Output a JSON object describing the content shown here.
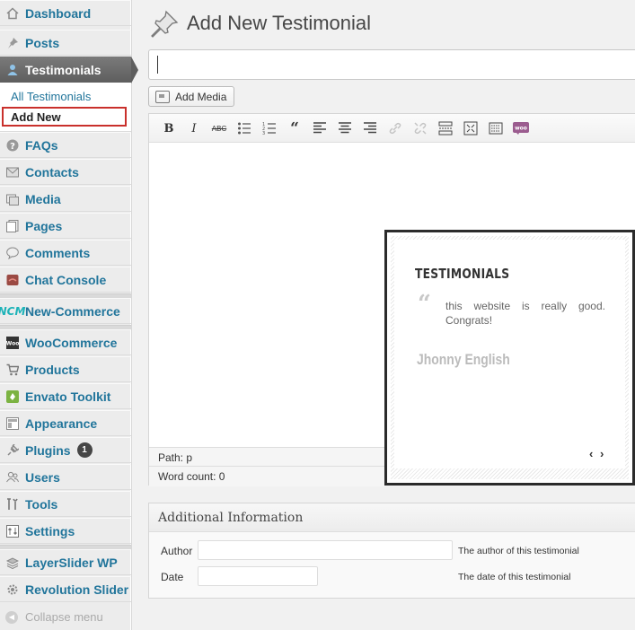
{
  "sidebar": {
    "items": [
      {
        "id": "dashboard",
        "label": "Dashboard",
        "icon": "home-icon"
      },
      {
        "id": "posts",
        "label": "Posts",
        "icon": "pin-icon"
      },
      {
        "id": "testimonials",
        "label": "Testimonials",
        "icon": "user-icon",
        "active": true
      },
      {
        "id": "faqs",
        "label": "FAQs",
        "icon": "question-icon"
      },
      {
        "id": "contacts",
        "label": "Contacts",
        "icon": "envelope-icon"
      },
      {
        "id": "media",
        "label": "Media",
        "icon": "media-icon"
      },
      {
        "id": "pages",
        "label": "Pages",
        "icon": "pages-icon"
      },
      {
        "id": "comments",
        "label": "Comments",
        "icon": "comment-icon"
      },
      {
        "id": "chat-console",
        "label": "Chat Console",
        "icon": "chat-icon"
      },
      {
        "id": "new-commerce",
        "label": "New-Commerce",
        "icon": "ncm-logo-icon",
        "icon_text": "NCM"
      },
      {
        "id": "woocommerce",
        "label": "WooCommerce",
        "icon": "woo-icon"
      },
      {
        "id": "products",
        "label": "Products",
        "icon": "cart-icon"
      },
      {
        "id": "envato-toolkit",
        "label": "Envato Toolkit",
        "icon": "envato-icon"
      },
      {
        "id": "appearance",
        "label": "Appearance",
        "icon": "appearance-icon"
      },
      {
        "id": "plugins",
        "label": "Plugins",
        "icon": "plug-icon",
        "badge": "1"
      },
      {
        "id": "users",
        "label": "Users",
        "icon": "users-icon"
      },
      {
        "id": "tools",
        "label": "Tools",
        "icon": "tools-icon"
      },
      {
        "id": "settings",
        "label": "Settings",
        "icon": "settings-icon"
      },
      {
        "id": "layerslider",
        "label": "LayerSlider WP",
        "icon": "layers-icon"
      },
      {
        "id": "revolution-slider",
        "label": "Revolution Slider",
        "icon": "gear-icon"
      }
    ],
    "submenu": {
      "all": "All Testimonials",
      "add_new": "Add New"
    },
    "collapse_label": "Collapse menu"
  },
  "main": {
    "title": "Add New Testimonial",
    "title_input_value": "",
    "add_media_label": "Add Media",
    "toolbar": [
      "bold",
      "italic",
      "strikethrough",
      "bullet-list",
      "numbered-list",
      "blockquote",
      "align-left",
      "align-center",
      "align-right",
      "link",
      "unlink",
      "read-more",
      "fullscreen",
      "kitchen-sink",
      "woocommerce-shortcode"
    ],
    "status_path": "Path: p",
    "word_count": "Word count: 0"
  },
  "preview": {
    "heading": "TESTIMONIALS",
    "quote": "this website is really good. Congrats!",
    "author": "Jhonny English",
    "nav": "‹ ›"
  },
  "additional_info": {
    "title": "Additional Information",
    "fields": [
      {
        "label": "Author",
        "value": "",
        "description": "The author of this testimonial"
      },
      {
        "label": "Date",
        "value": "",
        "description": "The date of this testimonial"
      }
    ]
  },
  "colors": {
    "link": "#21759b",
    "active_menu_bg": "#6d6d6d",
    "badge_bg": "#464646",
    "highlight_border": "#c9302c",
    "preview_border": "#2b2b2b"
  }
}
